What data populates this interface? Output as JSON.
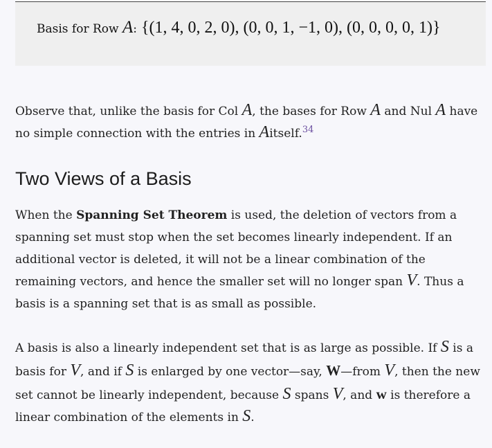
{
  "math_block": {
    "label": "Basis for Row ",
    "var": "A",
    "colon": ":",
    "formula": " {(1, 4, 0, 2, 0), (0, 0, 1, −1, 0), (0, 0, 0, 0, 1)}"
  },
  "para1": {
    "t1": "Observe that, unlike the basis for Col ",
    "v1": "A",
    "t2": ", the bases for Row ",
    "v2": "A",
    "t3": " and Nul ",
    "v3": "A",
    "t4": " have no simple connection with the entries in ",
    "v4": "A",
    "t5": "itself.",
    "footnote": "34"
  },
  "heading": "Two Views of a Basis",
  "para2": {
    "t1": "When the ",
    "bold": "Spanning Set Theorem",
    "t2": " is used, the deletion of vectors from a spanning set must stop when the set becomes linearly independent. If an additional vector is deleted, it will not be a linear combination of the remaining vectors, and hence the smaller set will no longer span ",
    "v1": "V",
    "t3": ". Thus a basis is a spanning set that is as small as possible."
  },
  "para3": {
    "t1": "A basis is also a linearly independent set that is as large as possible. If ",
    "v1": "S",
    "t2": " is a basis for ",
    "v2": "V",
    "t3": ", and if ",
    "v3": "S",
    "t4": " is enlarged by one vector—say, ",
    "b1": "W",
    "t5": "—from ",
    "v4": "V",
    "t6": ", then the new set cannot be linearly independent, because ",
    "v5": "S",
    "t7": " spans ",
    "v6": "V",
    "t8": ", and ",
    "b2": "w",
    "t9": " is therefore a linear combination of the elements in ",
    "v7": "S",
    "t10": "."
  }
}
